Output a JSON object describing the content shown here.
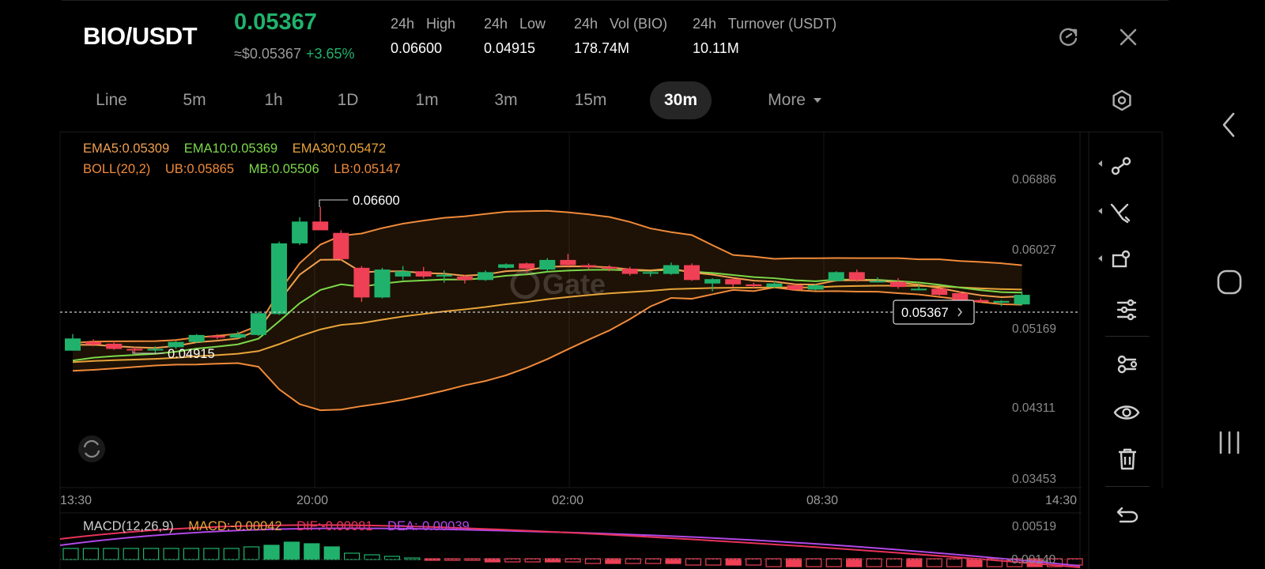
{
  "header": {
    "pair": "BIO/USDT",
    "last_price": "0.05367",
    "approx_usd": "≈$0.05367",
    "change_pct": "+3.65%",
    "stats": [
      {
        "label": "24h   High",
        "value": "0.06600"
      },
      {
        "label": "24h   Low",
        "value": "0.04915"
      },
      {
        "label": "24h   Vol (BIO)",
        "value": "178.74M"
      },
      {
        "label": "24h   Turnover (USDT)",
        "value": "10.11M"
      }
    ]
  },
  "tabs": [
    "Line",
    "5m",
    "1h",
    "1D",
    "1m",
    "3m",
    "15m",
    "30m",
    "More"
  ],
  "active_tab": "30m",
  "indicators": {
    "ema5": "EMA5:0.05309",
    "ema10": "EMA10:0.05369",
    "ema30": "EMA30:0.05472",
    "boll": "BOLL(20,2)",
    "ub": "UB:0.05865",
    "mb": "MB:0.05506",
    "lb": "LB:0.05147"
  },
  "price_axis": [
    "0.06886",
    "0.06027",
    "0.05169",
    "0.04311",
    "0.03453"
  ],
  "time_axis": [
    "13:30",
    "20:00",
    "02:00",
    "08:30",
    "14:30"
  ],
  "markers": {
    "high": "0.06600",
    "low": "0.04915",
    "current": "0.05367"
  },
  "watermark": "Gate",
  "macd": {
    "title": "MACD(12,26,9)",
    "macd": "MACD:-0.00042",
    "dif": "DIF:-0.00081",
    "dea": "DEA:-0.00039",
    "axis": [
      "0.00519",
      "-0.00140"
    ]
  },
  "colors": {
    "up": "#20b26c",
    "down": "#ef4056",
    "ema5": "#f0a050",
    "ema10": "#7cd84a",
    "ema30": "#e8a33a",
    "boll": "#f08a3a",
    "dif": "#e8335a",
    "dea": "#b048e8",
    "macd": "#e8a33a"
  },
  "right_tools": [
    "trend-line-icon",
    "cross-line-icon",
    "shape-icon",
    "adjust-icon",
    "indicator-icon",
    "eye-icon",
    "trash-icon",
    "undo-icon"
  ],
  "chart_data": {
    "type": "candlestick",
    "x_range": [
      "13:30",
      "14:30"
    ],
    "ylim": [
      0.03453,
      0.06886
    ],
    "candles": [
      {
        "o": 0.0495,
        "h": 0.0514,
        "l": 0.0495,
        "c": 0.0509
      },
      {
        "o": 0.0505,
        "h": 0.0508,
        "l": 0.05,
        "c": 0.0502
      },
      {
        "o": 0.0503,
        "h": 0.0506,
        "l": 0.0496,
        "c": 0.0497
      },
      {
        "o": 0.0497,
        "h": 0.0499,
        "l": 0.0492,
        "c": 0.0496
      },
      {
        "o": 0.0496,
        "h": 0.05,
        "l": 0.0492,
        "c": 0.0497
      },
      {
        "o": 0.0499,
        "h": 0.0506,
        "l": 0.0497,
        "c": 0.0505
      },
      {
        "o": 0.0505,
        "h": 0.0514,
        "l": 0.0504,
        "c": 0.0513
      },
      {
        "o": 0.0512,
        "h": 0.0514,
        "l": 0.0508,
        "c": 0.051
      },
      {
        "o": 0.051,
        "h": 0.0517,
        "l": 0.0509,
        "c": 0.0514
      },
      {
        "o": 0.0513,
        "h": 0.054,
        "l": 0.0512,
        "c": 0.0538
      },
      {
        "o": 0.0537,
        "h": 0.062,
        "l": 0.0536,
        "c": 0.0618
      },
      {
        "o": 0.0618,
        "h": 0.0648,
        "l": 0.0616,
        "c": 0.0643
      },
      {
        "o": 0.0643,
        "h": 0.066,
        "l": 0.0637,
        "c": 0.0633
      },
      {
        "o": 0.063,
        "h": 0.0633,
        "l": 0.0598,
        "c": 0.06
      },
      {
        "o": 0.059,
        "h": 0.0592,
        "l": 0.0551,
        "c": 0.0556
      },
      {
        "o": 0.0556,
        "h": 0.059,
        "l": 0.0555,
        "c": 0.0588
      },
      {
        "o": 0.058,
        "h": 0.0592,
        "l": 0.0576,
        "c": 0.0586
      },
      {
        "o": 0.0586,
        "h": 0.0591,
        "l": 0.0578,
        "c": 0.058
      },
      {
        "o": 0.058,
        "h": 0.0587,
        "l": 0.0573,
        "c": 0.0582
      },
      {
        "o": 0.058,
        "h": 0.0582,
        "l": 0.0572,
        "c": 0.0576
      },
      {
        "o": 0.0576,
        "h": 0.0587,
        "l": 0.0575,
        "c": 0.0585
      },
      {
        "o": 0.059,
        "h": 0.0595,
        "l": 0.0589,
        "c": 0.0594
      },
      {
        "o": 0.0595,
        "h": 0.0596,
        "l": 0.0584,
        "c": 0.0589
      },
      {
        "o": 0.0588,
        "h": 0.0601,
        "l": 0.0586,
        "c": 0.0599
      },
      {
        "o": 0.0599,
        "h": 0.0606,
        "l": 0.059,
        "c": 0.0593
      },
      {
        "o": 0.0593,
        "h": 0.0595,
        "l": 0.0588,
        "c": 0.0591
      },
      {
        "o": 0.0591,
        "h": 0.0593,
        "l": 0.0586,
        "c": 0.0589
      },
      {
        "o": 0.0589,
        "h": 0.0591,
        "l": 0.0581,
        "c": 0.0583
      },
      {
        "o": 0.0584,
        "h": 0.0586,
        "l": 0.058,
        "c": 0.0585
      },
      {
        "o": 0.0583,
        "h": 0.0596,
        "l": 0.0582,
        "c": 0.0593
      },
      {
        "o": 0.0593,
        "h": 0.0595,
        "l": 0.0575,
        "c": 0.0576
      },
      {
        "o": 0.0572,
        "h": 0.0578,
        "l": 0.0563,
        "c": 0.0577
      },
      {
        "o": 0.0577,
        "h": 0.0578,
        "l": 0.0568,
        "c": 0.0571
      },
      {
        "o": 0.0571,
        "h": 0.0573,
        "l": 0.0566,
        "c": 0.0569
      },
      {
        "o": 0.0568,
        "h": 0.0575,
        "l": 0.0567,
        "c": 0.0572
      },
      {
        "o": 0.057,
        "h": 0.0571,
        "l": 0.0564,
        "c": 0.0565
      },
      {
        "o": 0.0565,
        "h": 0.0571,
        "l": 0.0564,
        "c": 0.057
      },
      {
        "o": 0.0575,
        "h": 0.0586,
        "l": 0.0574,
        "c": 0.0585
      },
      {
        "o": 0.0585,
        "h": 0.0588,
        "l": 0.0574,
        "c": 0.0576
      },
      {
        "o": 0.0575,
        "h": 0.0579,
        "l": 0.0573,
        "c": 0.0575
      },
      {
        "o": 0.0574,
        "h": 0.0578,
        "l": 0.0566,
        "c": 0.0568
      },
      {
        "o": 0.0566,
        "h": 0.057,
        "l": 0.0564,
        "c": 0.0566
      },
      {
        "o": 0.0566,
        "h": 0.0567,
        "l": 0.0558,
        "c": 0.0559
      },
      {
        "o": 0.0561,
        "h": 0.0563,
        "l": 0.0552,
        "c": 0.0553
      },
      {
        "o": 0.0553,
        "h": 0.0555,
        "l": 0.055,
        "c": 0.0551
      },
      {
        "o": 0.055,
        "h": 0.0553,
        "l": 0.0546,
        "c": 0.0552
      },
      {
        "o": 0.0548,
        "h": 0.0563,
        "l": 0.0547,
        "c": 0.0559
      }
    ],
    "macd_hist": [
      -0.0007,
      -0.0007,
      -0.0007,
      -0.0007,
      -0.0007,
      -0.0007,
      -0.0007,
      -0.0007,
      -0.0007,
      -0.0008,
      -0.0009,
      -0.0011,
      -0.001,
      -0.0008,
      -0.0004,
      -0.0003,
      -0.0002,
      -0.0001,
      0.0001,
      0.0001,
      0.0001,
      0.0002,
      0.0002,
      0.0002,
      0.0002,
      0.0002,
      0.0003,
      0.0003,
      0.0003,
      0.0003,
      0.0003,
      0.0004,
      0.0004,
      0.0004,
      0.0004,
      0.0005,
      0.0005,
      0.0005,
      0.0005,
      0.0005,
      0.0005,
      0.0005,
      0.0005,
      0.0005,
      0.0005,
      0.0005,
      0.0005,
      0.0005,
      0.0005,
      0.0005,
      0.0004
    ]
  }
}
